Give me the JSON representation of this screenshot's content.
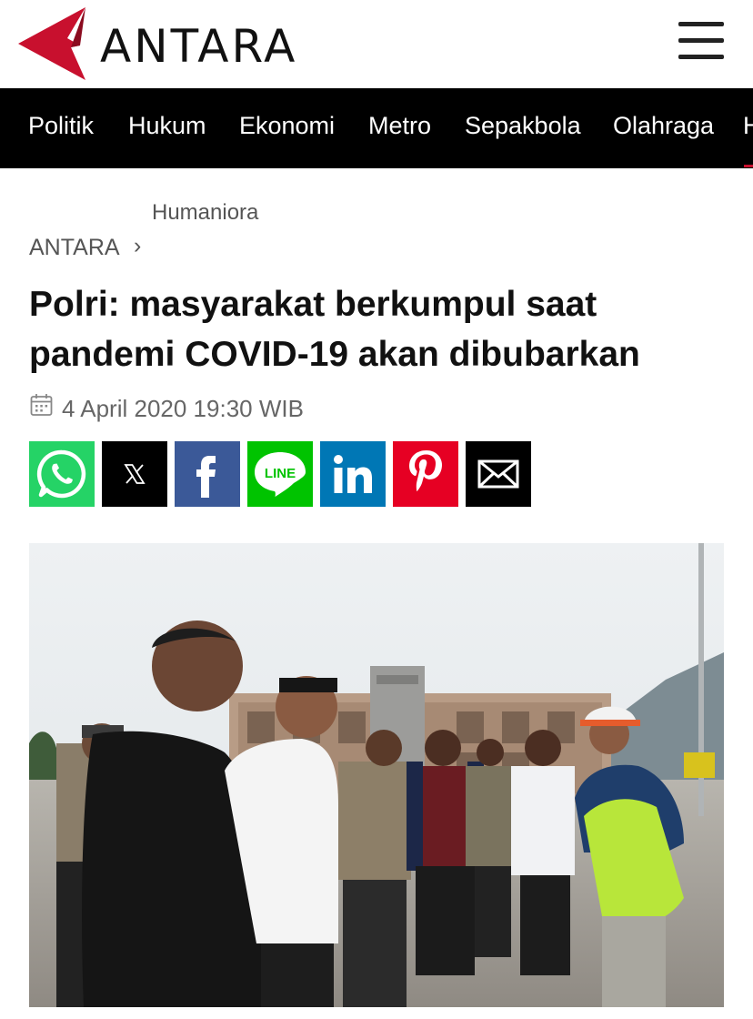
{
  "header": {
    "brand": "ANTARA",
    "brand_color": "#c8102e",
    "logo_icon": "antara-logo-icon",
    "menu_icon": "hamburger-menu-icon"
  },
  "nav": {
    "items": [
      {
        "label": "Politik"
      },
      {
        "label": "Hukum"
      },
      {
        "label": "Ekonomi"
      },
      {
        "label": "Metro"
      },
      {
        "label": "Sepakbola"
      },
      {
        "label": "Olahraga"
      },
      {
        "label": "H"
      }
    ]
  },
  "breadcrumb": {
    "category": "Humaniora",
    "home": "ANTARA",
    "separator": "›"
  },
  "article": {
    "title_line1": "Polri: masyarakat berkumpul saat",
    "title_line2": "pandemi COVID-19 akan dibubarkan",
    "date": "4 April 2020 19:30 WIB",
    "date_icon": "calendar-icon"
  },
  "share": {
    "buttons": [
      {
        "name": "whatsapp",
        "icon": "whatsapp-icon",
        "color": "#25d366"
      },
      {
        "name": "x",
        "icon": "x-icon",
        "color": "#000000"
      },
      {
        "name": "facebook",
        "icon": "facebook-icon",
        "color": "#3b5998"
      },
      {
        "name": "line",
        "icon": "line-icon",
        "color": "#00c300"
      },
      {
        "name": "linkedin",
        "icon": "linkedin-icon",
        "color": "#0077b5"
      },
      {
        "name": "pinterest",
        "icon": "pinterest-icon",
        "color": "#e60023"
      },
      {
        "name": "email",
        "icon": "email-icon",
        "color": "#000000"
      }
    ],
    "line_label": "LINE"
  },
  "photo": {
    "subject": "article-photo"
  }
}
